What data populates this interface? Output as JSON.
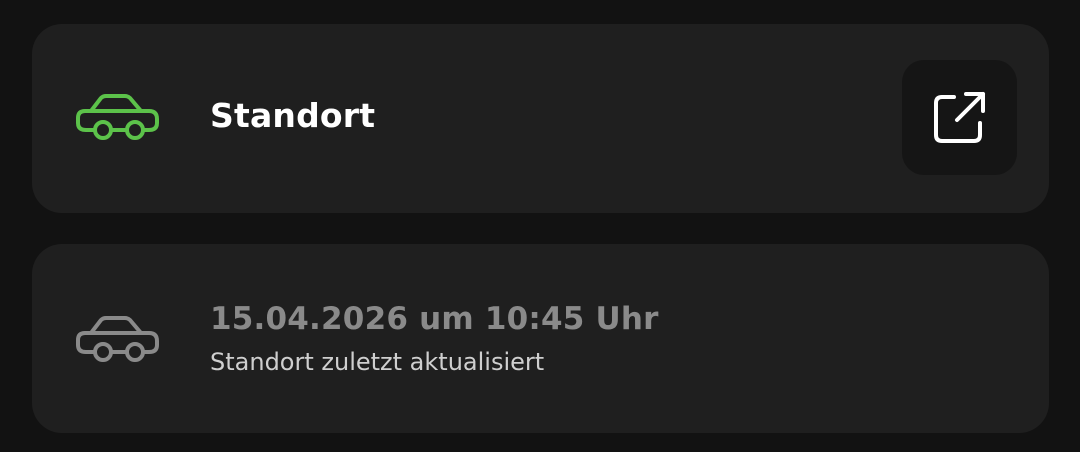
{
  "location_card": {
    "icon": "car-icon",
    "icon_color": "#5cc24a",
    "title": "Standort",
    "action_icon": "open-external-icon"
  },
  "updated_card": {
    "icon": "car-icon",
    "icon_color": "#8a8a8a",
    "timestamp": "15.04.2026 um 10:45 Uhr",
    "subtitle": "Standort zuletzt aktualisiert"
  }
}
